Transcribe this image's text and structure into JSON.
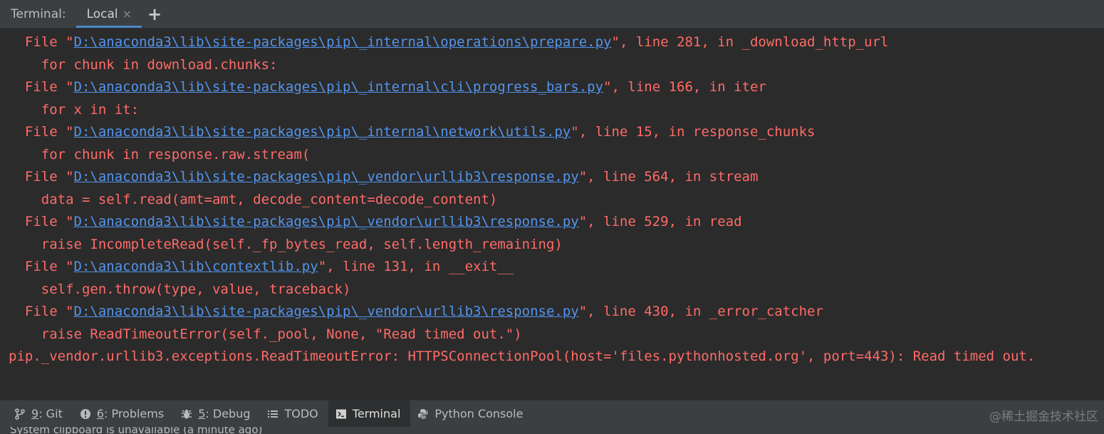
{
  "topbar": {
    "title": "Terminal:",
    "tab_label": "Local",
    "tab_close": "×",
    "add_label": "+"
  },
  "terminal": {
    "lines": [
      {
        "pre": "  File \"",
        "link": "D:\\anaconda3\\lib\\site-packages\\pip\\_internal\\operations\\prepare.py",
        "post": "\", line 281, in _download_http_url"
      },
      {
        "text": "    for chunk in download.chunks:"
      },
      {
        "pre": "  File \"",
        "link": "D:\\anaconda3\\lib\\site-packages\\pip\\_internal\\cli\\progress_bars.py",
        "post": "\", line 166, in iter"
      },
      {
        "text": "    for x in it:"
      },
      {
        "pre": "  File \"",
        "link": "D:\\anaconda3\\lib\\site-packages\\pip\\_internal\\network\\utils.py",
        "post": "\", line 15, in response_chunks"
      },
      {
        "text": "    for chunk in response.raw.stream("
      },
      {
        "pre": "  File \"",
        "link": "D:\\anaconda3\\lib\\site-packages\\pip\\_vendor\\urllib3\\response.py",
        "post": "\", line 564, in stream"
      },
      {
        "text": "    data = self.read(amt=amt, decode_content=decode_content)"
      },
      {
        "pre": "  File \"",
        "link": "D:\\anaconda3\\lib\\site-packages\\pip\\_vendor\\urllib3\\response.py",
        "post": "\", line 529, in read"
      },
      {
        "text": "    raise IncompleteRead(self._fp_bytes_read, self.length_remaining)"
      },
      {
        "pre": "  File \"",
        "link": "D:\\anaconda3\\lib\\contextlib.py",
        "post": "\", line 131, in __exit__"
      },
      {
        "text": "    self.gen.throw(type, value, traceback)"
      },
      {
        "pre": "  File \"",
        "link": "D:\\anaconda3\\lib\\site-packages\\pip\\_vendor\\urllib3\\response.py",
        "post": "\", line 430, in _error_catcher"
      },
      {
        "text": "    raise ReadTimeoutError(self._pool, None, \"Read timed out.\")"
      },
      {
        "text": "pip._vendor.urllib3.exceptions.ReadTimeoutError: HTTPSConnectionPool(host='files.pythonhosted.org', port=443): Read timed out."
      }
    ]
  },
  "toolbar": {
    "git": {
      "mnemonic": "9",
      "label": ": Git"
    },
    "problems": {
      "mnemonic": "6",
      "label": ": Problems"
    },
    "debug": {
      "mnemonic": "5",
      "label": ": Debug"
    },
    "todo": {
      "label": "TODO"
    },
    "terminal": {
      "label": "Terminal"
    },
    "python_console": {
      "label": "Python Console"
    }
  },
  "watermark": "@稀土掘金技术社区",
  "status": {
    "text": "System clipboard is unavailable (a minute ago)"
  },
  "colors": {
    "error_text": "#ff6b68",
    "link": "#5394ec",
    "accent": "#4a88c7"
  }
}
